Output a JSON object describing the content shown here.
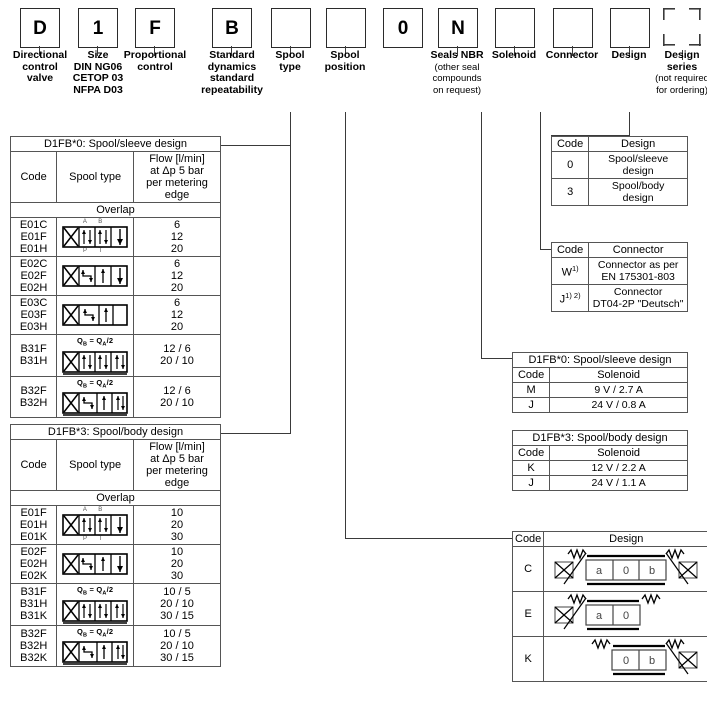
{
  "header": {
    "boxes": [
      {
        "code": "D",
        "dashed": false
      },
      {
        "code": "1",
        "dashed": false
      },
      {
        "code": "F",
        "dashed": false
      },
      {
        "code": "B",
        "dashed": false
      },
      {
        "code": "",
        "dashed": false
      },
      {
        "code": "",
        "dashed": false
      },
      {
        "code": "0",
        "dashed": false
      },
      {
        "code": "N",
        "dashed": false
      },
      {
        "code": "",
        "dashed": false
      },
      {
        "code": "",
        "dashed": false
      },
      {
        "code": "",
        "dashed": false
      },
      {
        "code": "",
        "dashed": true
      }
    ],
    "labels": [
      {
        "main": "Directional\ncontrol\nvalve",
        "sub": ""
      },
      {
        "main": "Size",
        "sub": "DIN NG06\nCETOP 03\nNFPA D03"
      },
      {
        "main": "Proportional\ncontrol",
        "sub": ""
      },
      {
        "main": "Standard\ndynamics\nstandard\nrepeatability",
        "sub": ""
      },
      {
        "main": "Spool\ntype",
        "sub": ""
      },
      {
        "main": "Spool\nposition",
        "sub": ""
      },
      {
        "main": "",
        "sub": ""
      },
      {
        "main": "Seals NBR",
        "sub": "(other seal\ncompounds\non request)"
      },
      {
        "main": "Solenoid",
        "sub": ""
      },
      {
        "main": "Connector",
        "sub": ""
      },
      {
        "main": "Design",
        "sub": ""
      },
      {
        "main": "Design\nseries",
        "sub": "(not required\nfor ordering)"
      }
    ]
  },
  "spool_sleeve_table": {
    "title": "D1FB*0: Spool/sleeve design",
    "columns": [
      "Code",
      "Spool type",
      "Flow [l/min]\nat Δp 5 bar\nper metering edge"
    ],
    "col_flow_line1": "Flow [l/min]",
    "col_flow_line2": "at Δp 5 bar",
    "col_flow_line3": "per metering edge",
    "section": "Overlap",
    "rows": [
      {
        "codes": [
          "E01C",
          "E01F",
          "E01H"
        ],
        "symbol": "e01",
        "note": "",
        "flows": [
          "6",
          "12",
          "20"
        ]
      },
      {
        "codes": [
          "E02C",
          "E02F",
          "E02H"
        ],
        "symbol": "e02",
        "note": "",
        "flows": [
          "6",
          "12",
          "20"
        ]
      },
      {
        "codes": [
          "E03C",
          "E03F",
          "E03H"
        ],
        "symbol": "e03",
        "note": "",
        "flows": [
          "6",
          "12",
          "20"
        ]
      },
      {
        "codes": [
          "B31F",
          "B31H"
        ],
        "symbol": "b31",
        "note": "QB = QA/2",
        "flows": [
          "12 / 6",
          "20 / 10"
        ]
      },
      {
        "codes": [
          "B32F",
          "B32H"
        ],
        "symbol": "b32",
        "note": "QB = QA/2",
        "flows": [
          "12 / 6",
          "20 / 10"
        ]
      }
    ]
  },
  "spool_body_table": {
    "title": "D1FB*3: Spool/body design",
    "columns": [
      "Code",
      "Spool type",
      "Flow [l/min]\nat Δp 5 bar\nper metering edge"
    ],
    "col_flow_line1": "Flow [l/min]",
    "col_flow_line2": "at Δp 5 bar",
    "col_flow_line3": "per metering edge",
    "section": "Overlap",
    "rows": [
      {
        "codes": [
          "E01F",
          "E01H",
          "E01K"
        ],
        "symbol": "e01",
        "note": "",
        "flows": [
          "10",
          "20",
          "30"
        ]
      },
      {
        "codes": [
          "E02F",
          "E02H",
          "E02K"
        ],
        "symbol": "e02",
        "note": "",
        "flows": [
          "10",
          "20",
          "30"
        ]
      },
      {
        "codes": [
          "B31F",
          "B31H",
          "B31K"
        ],
        "symbol": "b31",
        "note": "QB = QA/2",
        "flows": [
          "10 / 5",
          "20 / 10",
          "30 / 15"
        ]
      },
      {
        "codes": [
          "B32F",
          "B32H",
          "B32K"
        ],
        "symbol": "b32",
        "note": "QB = QA/2",
        "flows": [
          "10 / 5",
          "20 / 10",
          "30 / 15"
        ]
      }
    ]
  },
  "design_table": {
    "columns": [
      "Code",
      "Design"
    ],
    "rows": [
      {
        "code": "0",
        "value": "Spool/sleeve\ndesign",
        "line1": "Spool/sleeve",
        "line2": "design"
      },
      {
        "code": "3",
        "value": "Spool/body\ndesign",
        "line1": "Spool/body",
        "line2": "design"
      }
    ]
  },
  "connector_table": {
    "columns": [
      "Code",
      "Connector"
    ],
    "rows": [
      {
        "code": "W",
        "sup": "1)",
        "line1": "Connector as per",
        "line2": "EN 175301-803"
      },
      {
        "code": "J",
        "sup": "1) 2)",
        "line1": "Connector",
        "line2": "DT04-2P \"Deutsch\""
      }
    ]
  },
  "solenoid_sleeve_table": {
    "title": "D1FB*0: Spool/sleeve design",
    "columns": [
      "Code",
      "Solenoid"
    ],
    "rows": [
      {
        "code": "M",
        "value": "9 V / 2.7 A"
      },
      {
        "code": "J",
        "value": "24 V / 0.8 A"
      }
    ]
  },
  "solenoid_body_table": {
    "title": "D1FB*3: Spool/body design",
    "columns": [
      "Code",
      "Solenoid"
    ],
    "rows": [
      {
        "code": "K",
        "value": "12 V / 2.2 A"
      },
      {
        "code": "J",
        "value": "24 V / 1.1 A"
      }
    ]
  },
  "position_design_table": {
    "columns": [
      "Code",
      "Design"
    ],
    "rows": [
      {
        "code": "C",
        "cells": [
          "a",
          "0",
          "b"
        ],
        "spring_left": true,
        "spring_right": true
      },
      {
        "code": "E",
        "cells": [
          "a",
          "0"
        ],
        "spring_left": true,
        "spring_right": true
      },
      {
        "code": "K",
        "cells": [
          "0",
          "b"
        ],
        "spring_left": true,
        "spring_right": true
      }
    ]
  }
}
